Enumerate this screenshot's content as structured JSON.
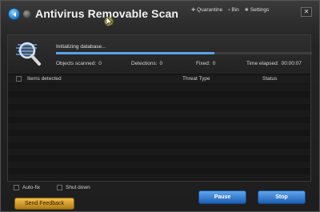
{
  "app": {
    "title": "Antivirus Removable Scan",
    "accent_color": "#5aa2e8",
    "nav": {
      "back_icon": "back-arrow-icon",
      "forward_icon": "forward-icon"
    }
  },
  "toplinks": [
    {
      "label": "Quarantine",
      "icon": "quarantine-icon"
    },
    {
      "label": "Bin",
      "icon": "bin-icon"
    },
    {
      "label": "Settings",
      "icon": "settings-icon"
    }
  ],
  "close_label": "✕",
  "scan": {
    "status": "Initializing database...",
    "progress_fraction": 0.62,
    "objects_scanned_label": "Objects scanned:",
    "objects_scanned_value": "0",
    "detections_label": "Detections:",
    "detections_value": "0",
    "fixed_label": "Fixed:",
    "fixed_value": "0",
    "time_elapsed_label": "Time elapsed:",
    "time_elapsed_value": "00:00:07"
  },
  "table": {
    "columns": [
      "Items detected",
      "Threat Type",
      "Status"
    ]
  },
  "options": {
    "auto_fix": "Auto-fix",
    "shut_down": "Shut down"
  },
  "buttons": {
    "send_feedback": "Send Feedback",
    "pause": "Pause",
    "stop": "Stop"
  }
}
